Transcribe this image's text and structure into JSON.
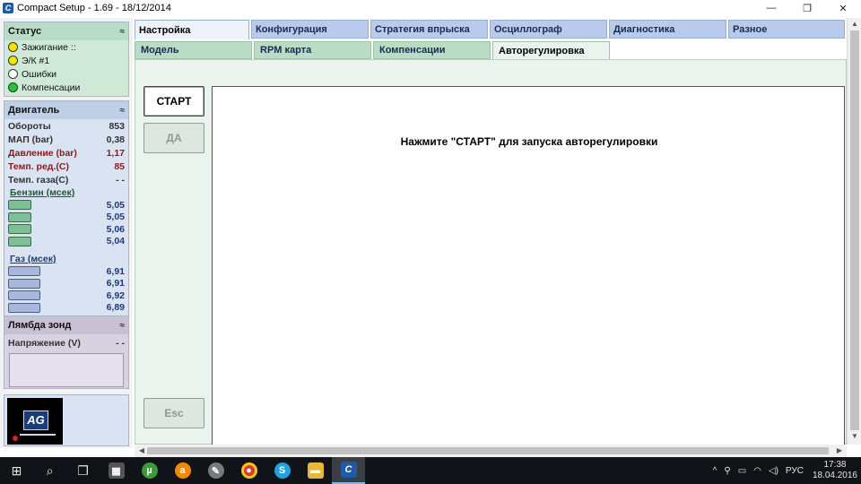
{
  "window": {
    "title": "Compact Setup - 1.69 - 18/12/2014",
    "icon": "compact-setup-icon",
    "controls": {
      "minimize": "—",
      "maximize": "❐",
      "close": "✕"
    }
  },
  "status_panel": {
    "title": "Статус",
    "collapse": "≈",
    "items": [
      {
        "label": "Зажигание ::",
        "color": "#f5e400"
      },
      {
        "label": "Э/К #1",
        "color": "#f5e400"
      },
      {
        "label": "Ошибки",
        "color": "#ffffff"
      },
      {
        "label": "Компенсации",
        "color": "#22c43a"
      }
    ]
  },
  "engine_panel": {
    "title": "Двигатель",
    "collapse": "≈",
    "rows": [
      {
        "label": "Обороты",
        "value": "853"
      },
      {
        "label": "МАП (bar)",
        "value": "0,38"
      },
      {
        "label": "Давление (bar)",
        "value": "1,17"
      },
      {
        "label": "Темп. ред.(С)",
        "value": "85"
      },
      {
        "label": "Темп. газа(С)",
        "value": "- -"
      }
    ],
    "petrol_label": "Бензин (мсек)",
    "petrol": [
      "5,05",
      "5,05",
      "5,06",
      "5,04"
    ],
    "gas_label": "Газ (мсек)",
    "gas": [
      "6,91",
      "6,91",
      "6,92",
      "6,89"
    ]
  },
  "lambda_panel": {
    "title": "Лямбда зонд",
    "collapse": "≈",
    "row_label": "Напряжение (V)",
    "row_value": "- -"
  },
  "logo": {
    "text": "AG"
  },
  "tabs": [
    "Настройка",
    "Конфигурация",
    "Стратегия впрыска",
    "Осциллограф",
    "Диагностика",
    "Разное"
  ],
  "subtabs": [
    "Модель",
    "RPM карта",
    "Компенсации",
    "Авторегулировка"
  ],
  "buttons": {
    "start": "СТАРТ",
    "yes": "ДА",
    "esc": "Esc"
  },
  "message": "Нажмите \"СТАРТ\" для запуска авторегулировки",
  "taskbar": {
    "apps": [
      "start-icon",
      "search-icon",
      "task-view-icon",
      "calculator-icon",
      "utorrent-icon",
      "avast-icon",
      "paint-icon",
      "chrome-icon",
      "skype-icon",
      "explorer-icon",
      "compact-setup-icon"
    ],
    "lang": "РУС",
    "time": "17:38",
    "date": "18.04.2016"
  }
}
